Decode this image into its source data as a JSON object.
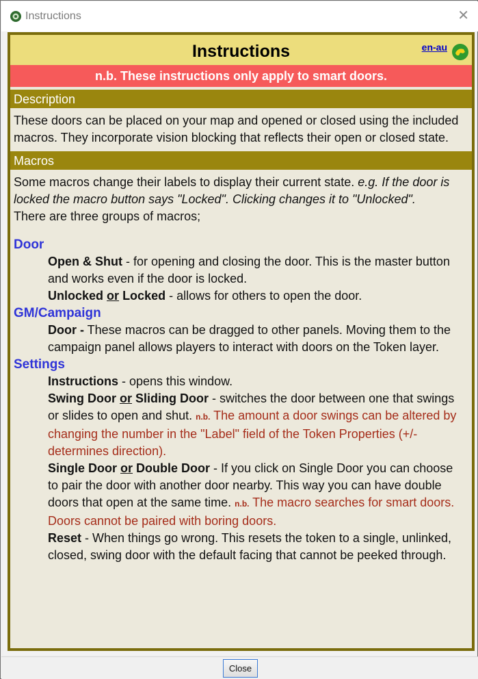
{
  "window": {
    "title": "Instructions",
    "close_glyph": "✕",
    "app_icon": "maptool-gear-icon"
  },
  "header": {
    "title": "Instructions",
    "lang_link": "en-au",
    "lang_icon": "flag-icon",
    "warning": "n.b. These instructions only apply to smart doors."
  },
  "colors": {
    "header_bg": "#ecdd7c",
    "warning_bg": "#f65a5a",
    "section_bg": "#9a860e",
    "group_text": "#2f34d8",
    "note_text": "#a52d1a",
    "frame_border": "#7a6c0c"
  },
  "description": {
    "heading": "Description",
    "text": "These doors can be placed on your map and opened or closed using the included macros. They incorporate vision blocking that reflects their open or closed state."
  },
  "macros": {
    "heading": "Macros",
    "intro": "Some macros change their labels to display their current state.",
    "intro_italic": "e.g. If the door is locked the macro button says \"Locked\". Clicking changes it to \"Unlocked\".",
    "groups_intro": "There are three groups of macros;",
    "door": {
      "title": "Door",
      "open_shut_label": "Open & Shut",
      "open_shut_text": " - for opening and closing the door. This is the master button and works even if the door is locked.",
      "unlocked_label": "Unlocked",
      "or": "or",
      "locked_label": "Locked",
      "locked_text": " - allows for others to open the door."
    },
    "gm": {
      "title": "GM/Campaign",
      "door_label": "Door -",
      "door_text": " These macros can be dragged to other panels. Moving them to the campaign panel allows players to interact with doors on the Token layer."
    },
    "settings": {
      "title": "Settings",
      "instructions_label": "Instructions",
      "instructions_text": " - opens this window.",
      "swing_label": "Swing Door",
      "sliding_label": "Sliding Door",
      "swing_text": " - switches the door between one that swings or slides to open and shut. ",
      "nb": "n.b.",
      "swing_note": " The amount a door swings can be altered by changing the number in the \"Label\" field of the Token Properties (+/- determines direction).",
      "single_label": "Single Door",
      "double_label": "Double Door",
      "single_text": " - If you click on Single Door you can choose to pair the door with another door nearby. This way you can have double doors that open at the same time. ",
      "single_note": " The macro searches for smart doors. Doors cannot be paired with boring doors.",
      "reset_label": "Reset",
      "reset_text": " - When things go wrong. This resets the token to a single, unlinked, closed, swing door with the default facing that cannot be peeked through."
    }
  },
  "footer": {
    "close_label": "Close"
  }
}
